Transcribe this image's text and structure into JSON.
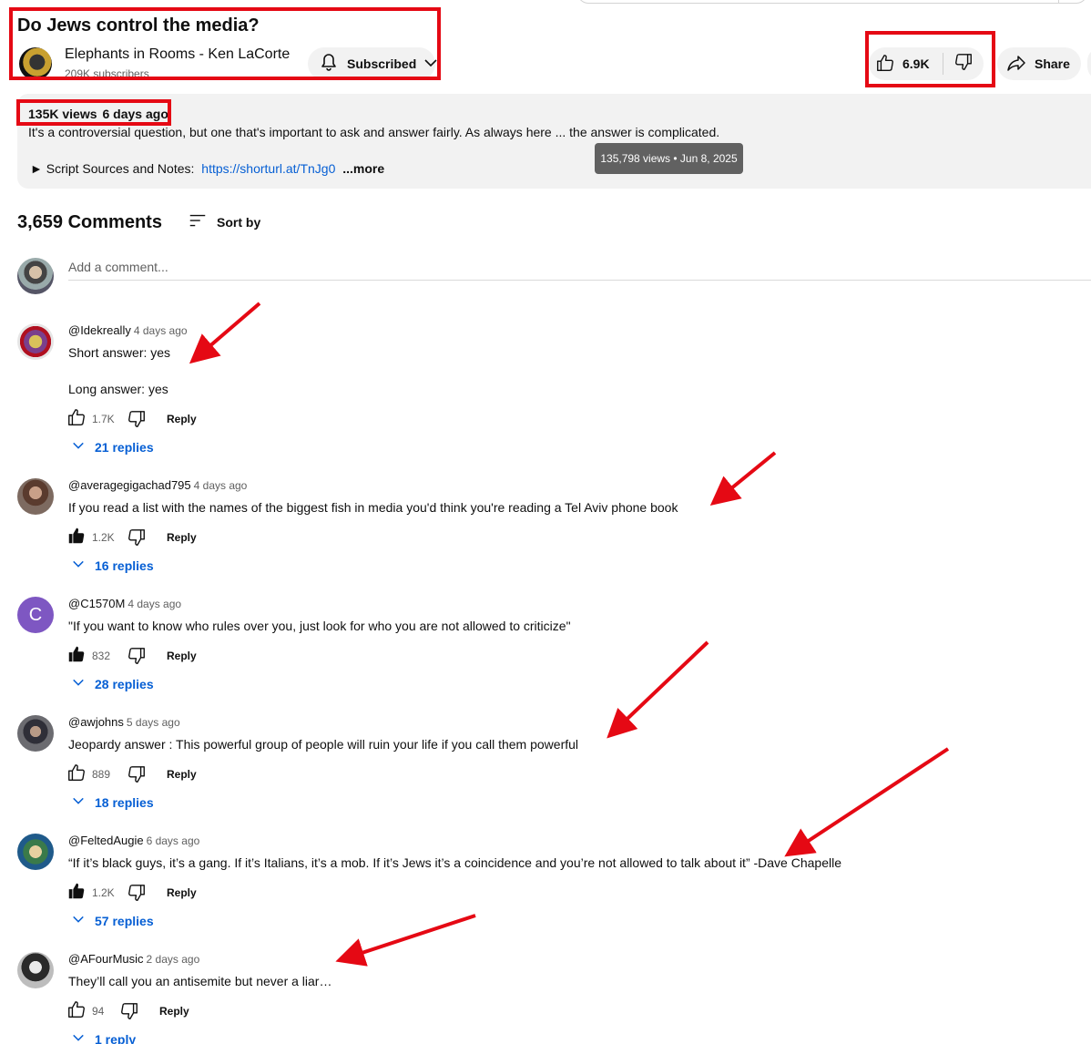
{
  "video": {
    "title": "Do Jews control the media?",
    "channel_name": "Elephants in Rooms - Ken LaCorte",
    "subscriber_count": "209K subscribers",
    "subscribe_label": "Subscribed",
    "like_count": "6.9K",
    "share_label": "Share"
  },
  "description": {
    "views": "135K views",
    "age": "6 days ago",
    "text": "It's a controversial question, but one that's important to ask and answer fairly. As always here ... the answer is complicated.",
    "script_label": "► Script Sources and Notes:",
    "link": "https://shorturl.at/TnJg0",
    "more_label": "...more",
    "tooltip": "135,798 views • Jun 8, 2025"
  },
  "comments_header": {
    "count_label": "3,659 Comments",
    "sort_label": "Sort by",
    "add_placeholder": "Add a comment..."
  },
  "comments": [
    {
      "author": "@Idekreally",
      "time": "4 days ago",
      "line1": "Short answer: yes",
      "line2": "Long answer: yes",
      "likes": "1.7K",
      "liked": false,
      "replies": "21 replies",
      "reply_label": "Reply"
    },
    {
      "author": "@averagegigachad795",
      "time": "4 days ago",
      "line1": "If you read a list with the names of the biggest fish in media you'd think you're reading a Tel Aviv phone book",
      "likes": "1.2K",
      "liked": true,
      "replies": "16 replies",
      "reply_label": "Reply"
    },
    {
      "author": "@C1570M",
      "time": "4 days ago",
      "line1": "\"If you want to know who rules over you, just look for who you are not allowed to criticize\"",
      "likes": "832",
      "liked": true,
      "replies": "28 replies",
      "reply_label": "Reply",
      "avatar_letter": "C"
    },
    {
      "author": "@awjohns",
      "time": "5 days ago",
      "line1": "Jeopardy answer : This powerful group of people will ruin your life if you call them powerful",
      "likes": "889",
      "liked": false,
      "replies": "18 replies",
      "reply_label": "Reply"
    },
    {
      "author": "@FeltedAugie",
      "time": "6 days ago",
      "line1": "“If it’s black guys, it’s a gang. If it’s Italians, it’s a mob. If it’s Jews it’s a coincidence and you’re not allowed to talk about it” -Dave Chapelle",
      "likes": "1.2K",
      "liked": true,
      "replies": "57 replies",
      "reply_label": "Reply"
    },
    {
      "author": "@AFourMusic",
      "time": "2 days ago",
      "line1": "They’ll call you an antisemite but never a liar…",
      "likes": "94",
      "liked": false,
      "replies": "1 reply",
      "reply_label": "Reply"
    }
  ],
  "colors": {
    "annotation_red": "#e50914",
    "link_blue": "#065fd4",
    "pill_gray": "#f2f2f2"
  }
}
